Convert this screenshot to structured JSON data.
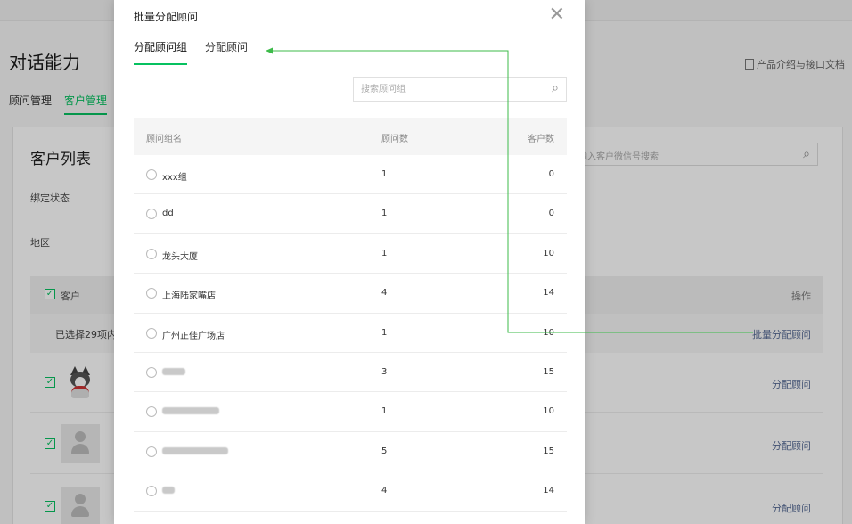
{
  "page": {
    "title": "对话能力",
    "doc_link": "产品介绍与接口文档",
    "tabs": [
      "顾问管理",
      "客户管理"
    ],
    "card_title": "客户列表",
    "search_placeholder": "输入客户微信号搜索",
    "filter_bind": "绑定状态",
    "filter_region": "地区",
    "table_header_customer": "客户",
    "table_header_ops": "操作",
    "selection_text": "已选择29项内容",
    "batch_assign": "批量分配顾问",
    "row_action": "分配顾问"
  },
  "modal": {
    "title": "批量分配顾问",
    "close_icon": "close-icon",
    "tabs": [
      {
        "label": "分配顾问组",
        "active": true
      },
      {
        "label": "分配顾问",
        "active": false
      }
    ],
    "search_placeholder": "搜索顾问组",
    "columns": {
      "name": "顾问组名",
      "count": "顾问数",
      "customers": "客户数"
    },
    "rows": [
      {
        "name": "xxx组",
        "count": "1",
        "customers": "0"
      },
      {
        "name": "dd",
        "count": "1",
        "customers": "0"
      },
      {
        "name": "龙头大厦",
        "count": "1",
        "customers": "10"
      },
      {
        "name": "上海陆家嘴店",
        "count": "4",
        "customers": "14"
      },
      {
        "name": "广州正佳广场店",
        "count": "1",
        "customers": "10"
      },
      {
        "name": "",
        "count": "3",
        "customers": "15",
        "blurred_width": 26
      },
      {
        "name": "",
        "count": "1",
        "customers": "10",
        "blurred_width": 64
      },
      {
        "name": "",
        "count": "5",
        "customers": "15",
        "blurred_width": 74
      },
      {
        "name": "",
        "count": "4",
        "customers": "14",
        "blurred_width": 14
      }
    ]
  },
  "colors": {
    "accent": "#07c160",
    "link": "#576b95",
    "arrow": "#3dbb4a"
  }
}
